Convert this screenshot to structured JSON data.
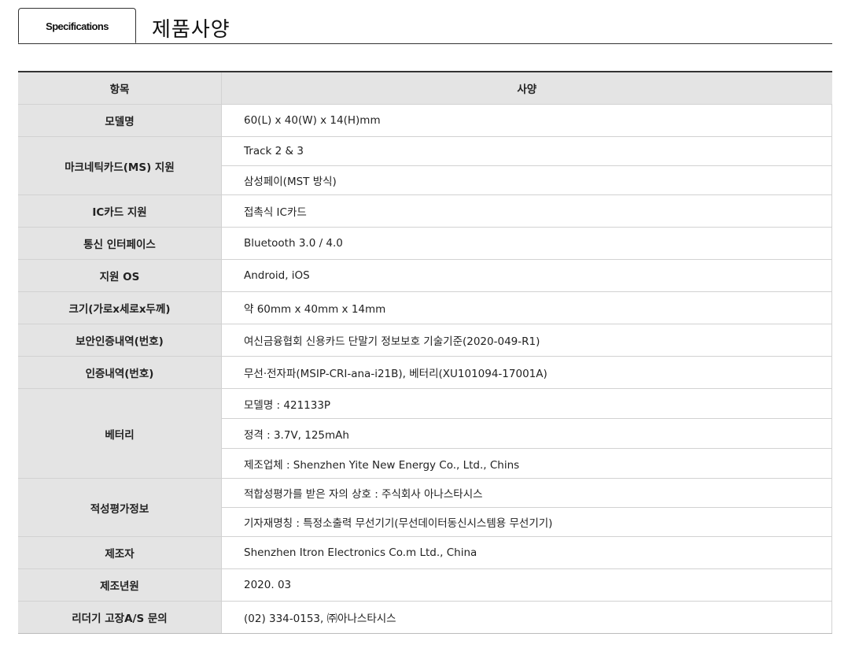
{
  "header": {
    "tab_label": "Specifications",
    "title": "제품사양"
  },
  "table": {
    "col_item": "항목",
    "col_spec": "사양",
    "rows": [
      {
        "label": "모델명",
        "values": [
          "60(L) x 40(W) x 14(H)mm"
        ]
      },
      {
        "label": "마크네틱카드(MS) 지원",
        "values": [
          "Track 2 & 3",
          "삼성페이(MST 방식)"
        ]
      },
      {
        "label": "IC카드 지원",
        "values": [
          "접촉식 IC카드"
        ]
      },
      {
        "label": "통신 인터페이스",
        "values": [
          "Bluetooth 3.0 / 4.0"
        ]
      },
      {
        "label": "지원 OS",
        "values": [
          "Android, iOS"
        ]
      },
      {
        "label": "크기(가로x세로x두께)",
        "values": [
          "약 60mm x 40mm x 14mm"
        ]
      },
      {
        "label": "보안인증내역(번호)",
        "values": [
          "여신금융협회 신용카드 단말기 정보보호 기술기준(2020-049-R1)"
        ]
      },
      {
        "label": "인증내역(번호)",
        "values": [
          "무선·전자파(MSIP-CRI-ana-i21B), 베터리(XU101094-17001A)"
        ]
      },
      {
        "label": "베터리",
        "values": [
          "모델명 : 421133P",
          "정격 : 3.7V, 125mAh",
          "제조업체 : Shenzhen Yite New Energy Co., Ltd., Chins"
        ]
      },
      {
        "label": "적성평가정보",
        "values": [
          "적합성평가를 받은 자의 상호 : 주식회사 아나스타시스",
          "기자재명칭 : 특정소출력 무선기기(무선데이터동신시스템용 무선기기)"
        ]
      },
      {
        "label": "제조자",
        "values": [
          "Shenzhen Itron Electronics Co.m Ltd., China"
        ]
      },
      {
        "label": "제조년원",
        "values": [
          "2020. 03"
        ]
      },
      {
        "label": "리더기 고장A/S 문의",
        "values": [
          "(02) 334-0153, ㈜아나스타시스"
        ]
      }
    ]
  }
}
